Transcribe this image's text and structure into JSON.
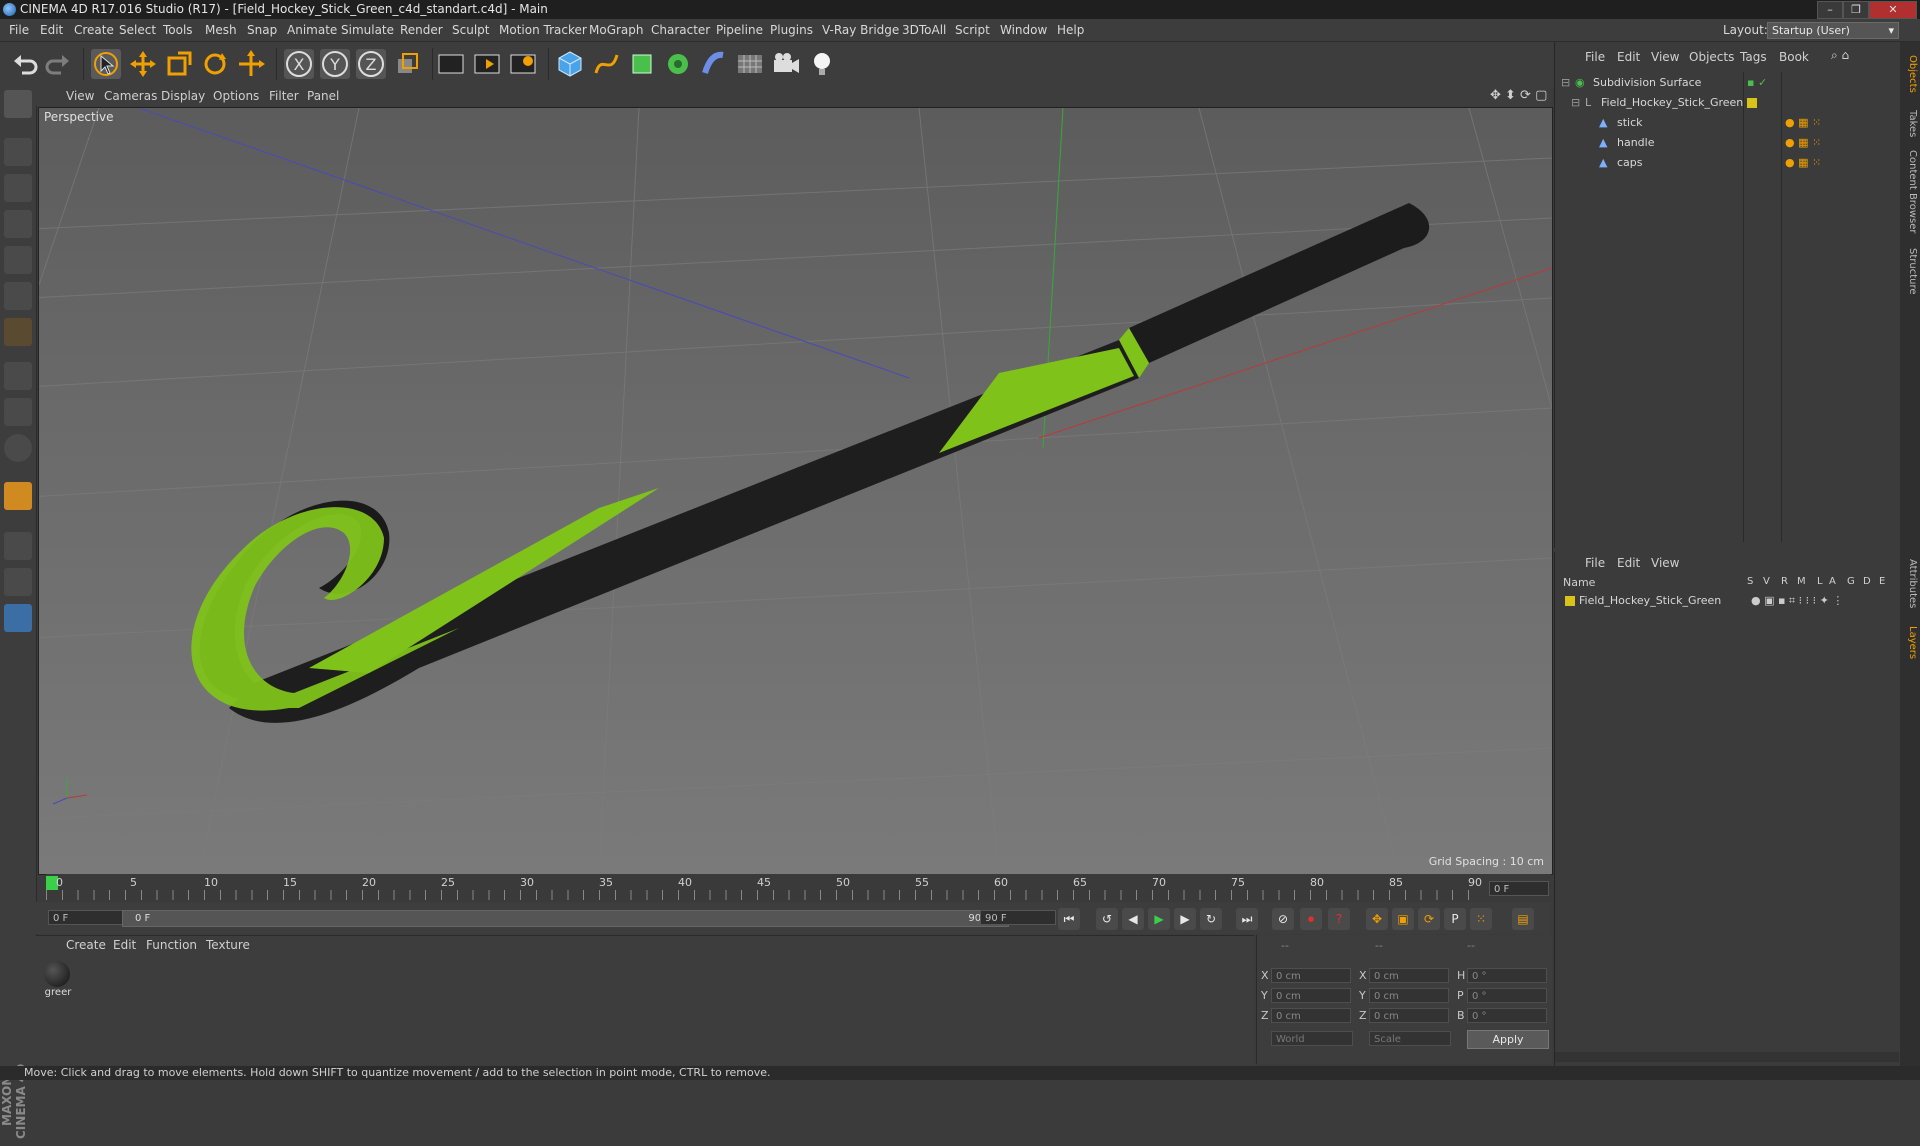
{
  "window": {
    "title": "CINEMA 4D R17.016 Studio (R17) - [Field_Hockey_Stick_Green_c4d_standart.c4d] - Main"
  },
  "menu": [
    "File",
    "Edit",
    "Create",
    "Select",
    "Tools",
    "Mesh",
    "Snap",
    "Animate",
    "Simulate",
    "Render",
    "Sculpt",
    "Motion Tracker",
    "MoGraph",
    "Character",
    "Pipeline",
    "Plugins",
    "V-Ray Bridge",
    "3DToAll",
    "Script",
    "Window",
    "Help"
  ],
  "layout": {
    "label": "Layout:",
    "value": "Startup (User)"
  },
  "viewport": {
    "menu": [
      "View",
      "Cameras",
      "Display",
      "Options",
      "Filter",
      "Panel"
    ],
    "camera_label": "Perspective",
    "grid_spacing": "Grid Spacing : 10 cm"
  },
  "timeline": {
    "ticks": [
      "0",
      "5",
      "10",
      "15",
      "20",
      "25",
      "30",
      "35",
      "40",
      "45",
      "50",
      "55",
      "60",
      "65",
      "70",
      "75",
      "80",
      "85",
      "90"
    ],
    "current_frame": "0 F",
    "start_field": "0 F",
    "range_start": "0 F",
    "range_end": "90 F",
    "end_field": "90 F"
  },
  "materials": {
    "menu": [
      "Create",
      "Edit",
      "Function",
      "Texture"
    ],
    "items": [
      {
        "name": "greer"
      }
    ]
  },
  "coordinates": {
    "headers": [
      "--",
      "--",
      "--"
    ],
    "rows": [
      {
        "l1": "X",
        "v1": "0 cm",
        "l2": "X",
        "v2": "0 cm",
        "l3": "H",
        "v3": "0 °"
      },
      {
        "l1": "Y",
        "v1": "0 cm",
        "l2": "Y",
        "v2": "0 cm",
        "l3": "P",
        "v3": "0 °"
      },
      {
        "l1": "Z",
        "v1": "0 cm",
        "l2": "Z",
        "v2": "0 cm",
        "l3": "B",
        "v3": "0 °"
      }
    ],
    "world": "World",
    "scale": "Scale",
    "apply": "Apply"
  },
  "objects": {
    "menu": [
      "File",
      "Edit",
      "View",
      "Objects",
      "Tags",
      "Book"
    ],
    "items": [
      {
        "name": "Subdivision Surface",
        "indent": 0
      },
      {
        "name": "Field_Hockey_Stick_Green",
        "indent": 1
      },
      {
        "name": "stick",
        "indent": 2
      },
      {
        "name": "handle",
        "indent": 2
      },
      {
        "name": "caps",
        "indent": 2
      }
    ]
  },
  "layers": {
    "menu": [
      "File",
      "Edit",
      "View"
    ],
    "col_name": "Name",
    "cols": [
      "S",
      "V",
      "R",
      "M",
      "L",
      "A",
      "G",
      "D",
      "E"
    ],
    "items": [
      {
        "name": "Field_Hockey_Stick_Green",
        "color": "#d9c21a"
      }
    ]
  },
  "side_tabs": [
    "Objects",
    "Takes",
    "Content Browser",
    "Structure",
    "Attributes",
    "Layers"
  ],
  "brand": "MAXON CINEMA 4D",
  "status": "Move: Click and drag to move elements. Hold down SHIFT to quantize movement / add to the selection in point mode, CTRL to remove.",
  "colors": {
    "accent": "#f0a000",
    "stick_green": "#7fc21a",
    "stick_black": "#1e1e1e"
  },
  "icons": [
    "undo-icon",
    "redo-icon",
    "select-icon",
    "move-icon",
    "scale-icon",
    "rotate-icon",
    "axis-x-icon",
    "axis-y-icon",
    "axis-z-icon",
    "render-icon",
    "cube-icon",
    "light-icon",
    "camera-icon"
  ]
}
